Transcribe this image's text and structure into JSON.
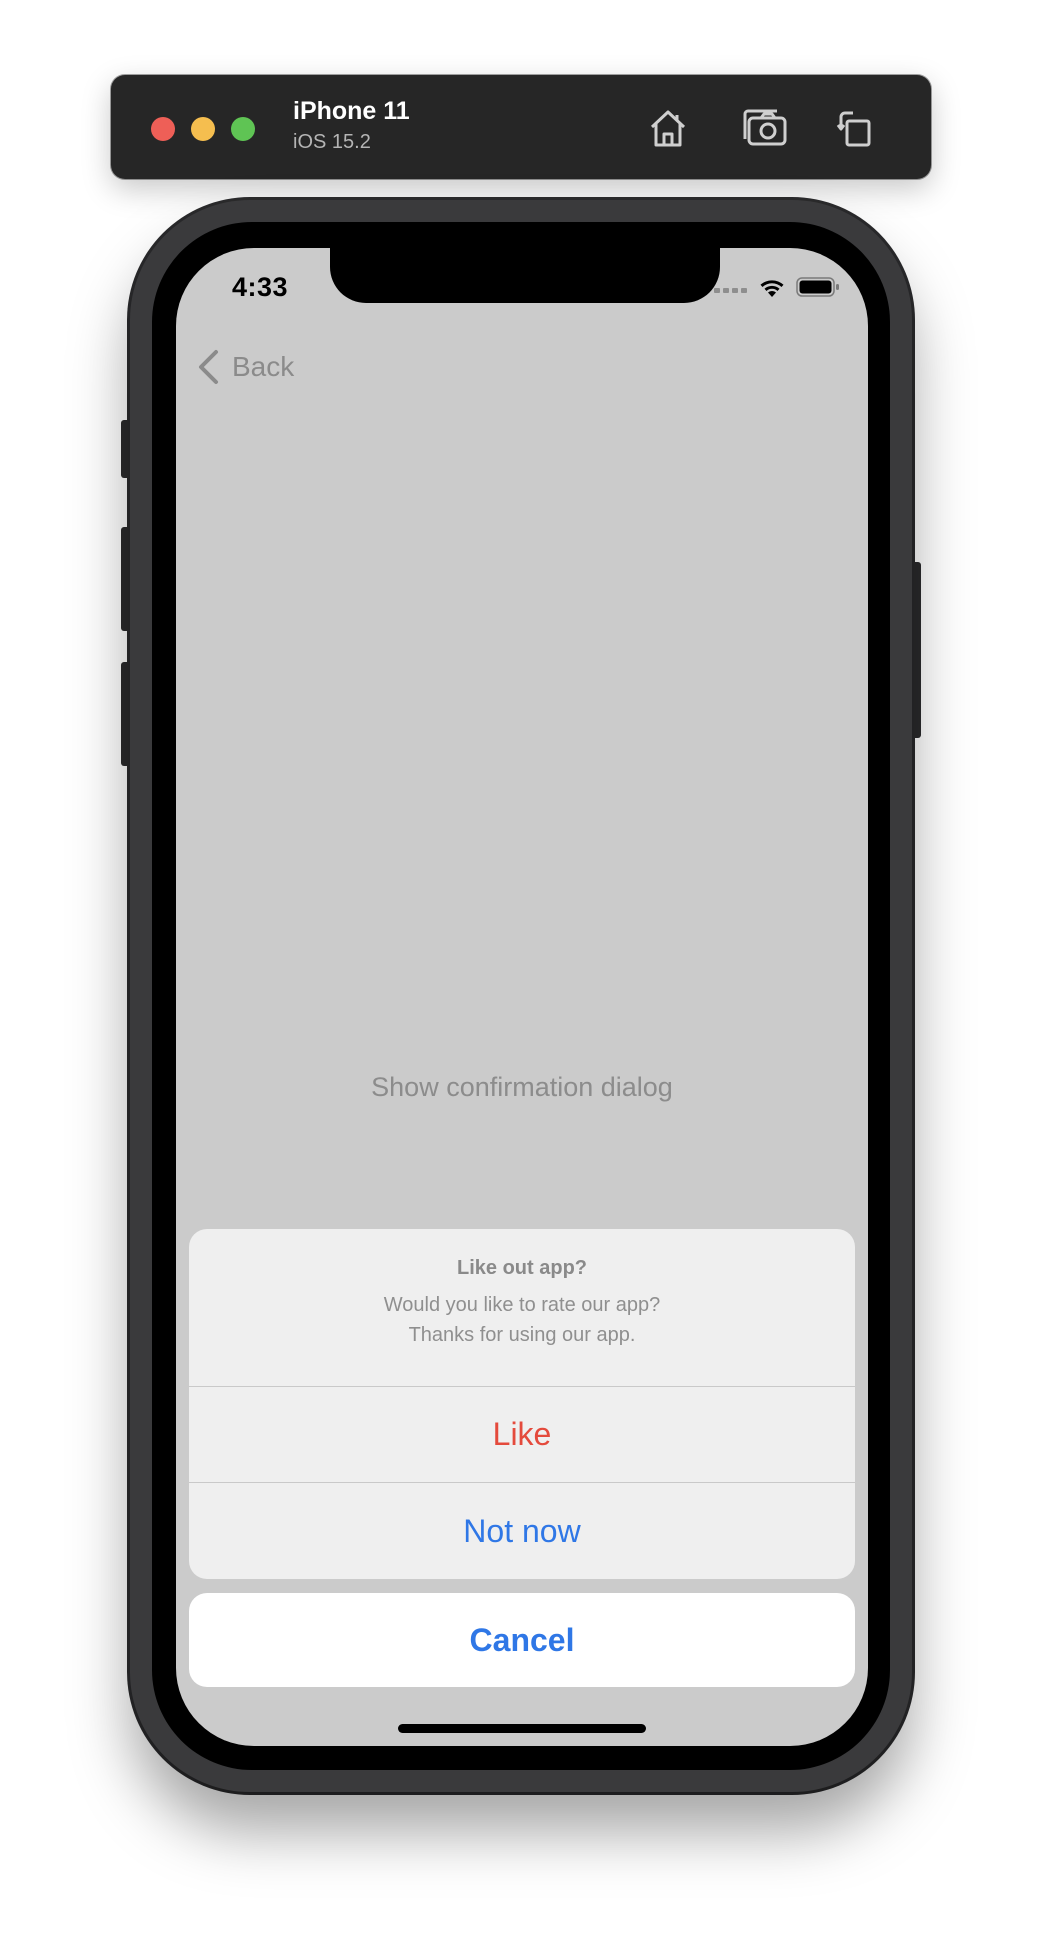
{
  "simulator": {
    "device_name": "iPhone 11",
    "os_version": "iOS 15.2",
    "icons": [
      "home-icon",
      "screenshot-icon",
      "rotate-icon"
    ]
  },
  "status_bar": {
    "time": "4:33",
    "icons": [
      "signal-icon",
      "wifi-icon",
      "battery-icon"
    ]
  },
  "nav": {
    "back_label": "Back"
  },
  "main": {
    "show_dialog_label": "Show confirmation dialog"
  },
  "action_sheet": {
    "title": "Like out app?",
    "message_line1": "Would you like to rate our app?",
    "message_line2": "Thanks for using our app.",
    "actions": [
      {
        "label": "Like",
        "style": "destructive",
        "color": "#e44a3c"
      },
      {
        "label": "Not now",
        "style": "default",
        "color": "#2f77e6"
      }
    ],
    "cancel_label": "Cancel"
  },
  "colors": {
    "accent": "#2f77e6",
    "destructive": "#e44a3c",
    "dimmed_background": "#cbcbcb"
  }
}
